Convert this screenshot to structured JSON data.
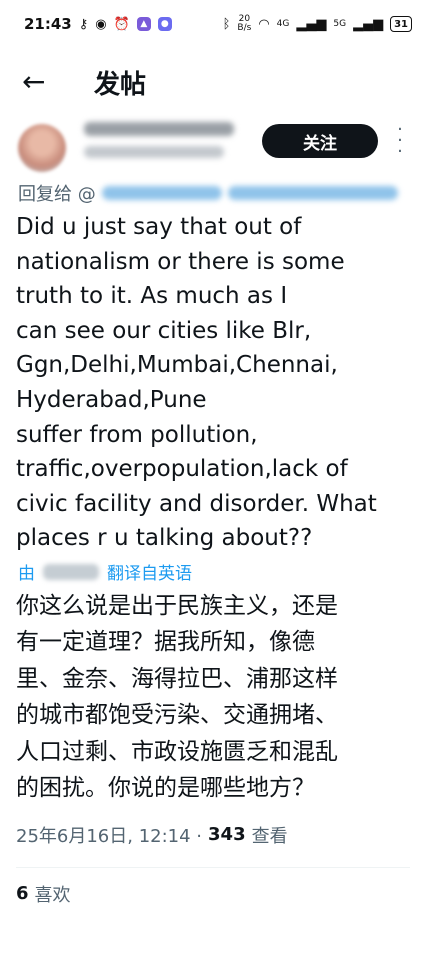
{
  "status_bar": {
    "time": "21:43",
    "left_icons": [
      "key-icon",
      "eye-icon",
      "alarm-icon",
      "app-icon",
      "app-badge-icon"
    ],
    "data_rate_top": "20",
    "data_rate_bottom": "B/s",
    "network_1": "4G",
    "network_2": "5G",
    "battery": "31"
  },
  "header": {
    "title": "发帖"
  },
  "author": {
    "follow_label": "关注"
  },
  "reply_to": {
    "prefix": "回复给 @"
  },
  "tweet": {
    "text": "Did u just say that out of\nnationalism or there is some\ntruth to it. As much as I\ncan see our cities like Blr,\nGgn,Delhi,Mumbai,Chennai,\nHyderabad,Pune\nsuffer from pollution,\ntraffic,overpopulation,lack of\ncivic facility and disorder. What\nplaces r u talking about??"
  },
  "translation": {
    "by_prefix": "由",
    "label": "翻译自英语",
    "text": "你这么说是出于民族主义，还是\n有一定道理？据我所知，像德\n里、金奈、海得拉巴、浦那这样\n的城市都饱受污染、交通拥堵、\n人口过剩、市政设施匮乏和混乱\n的困扰。你说的是哪些地方？"
  },
  "meta": {
    "datetime": "25年6月16日, 12:14 ·",
    "views_count": "343",
    "views_label": "查看"
  },
  "engagement": {
    "likes_count": "6",
    "likes_label": "喜欢"
  },
  "colors": {
    "accent": "#1d9bf0",
    "text": "#0f1419",
    "secondary": "#536471",
    "button_bg": "#0f1419"
  }
}
